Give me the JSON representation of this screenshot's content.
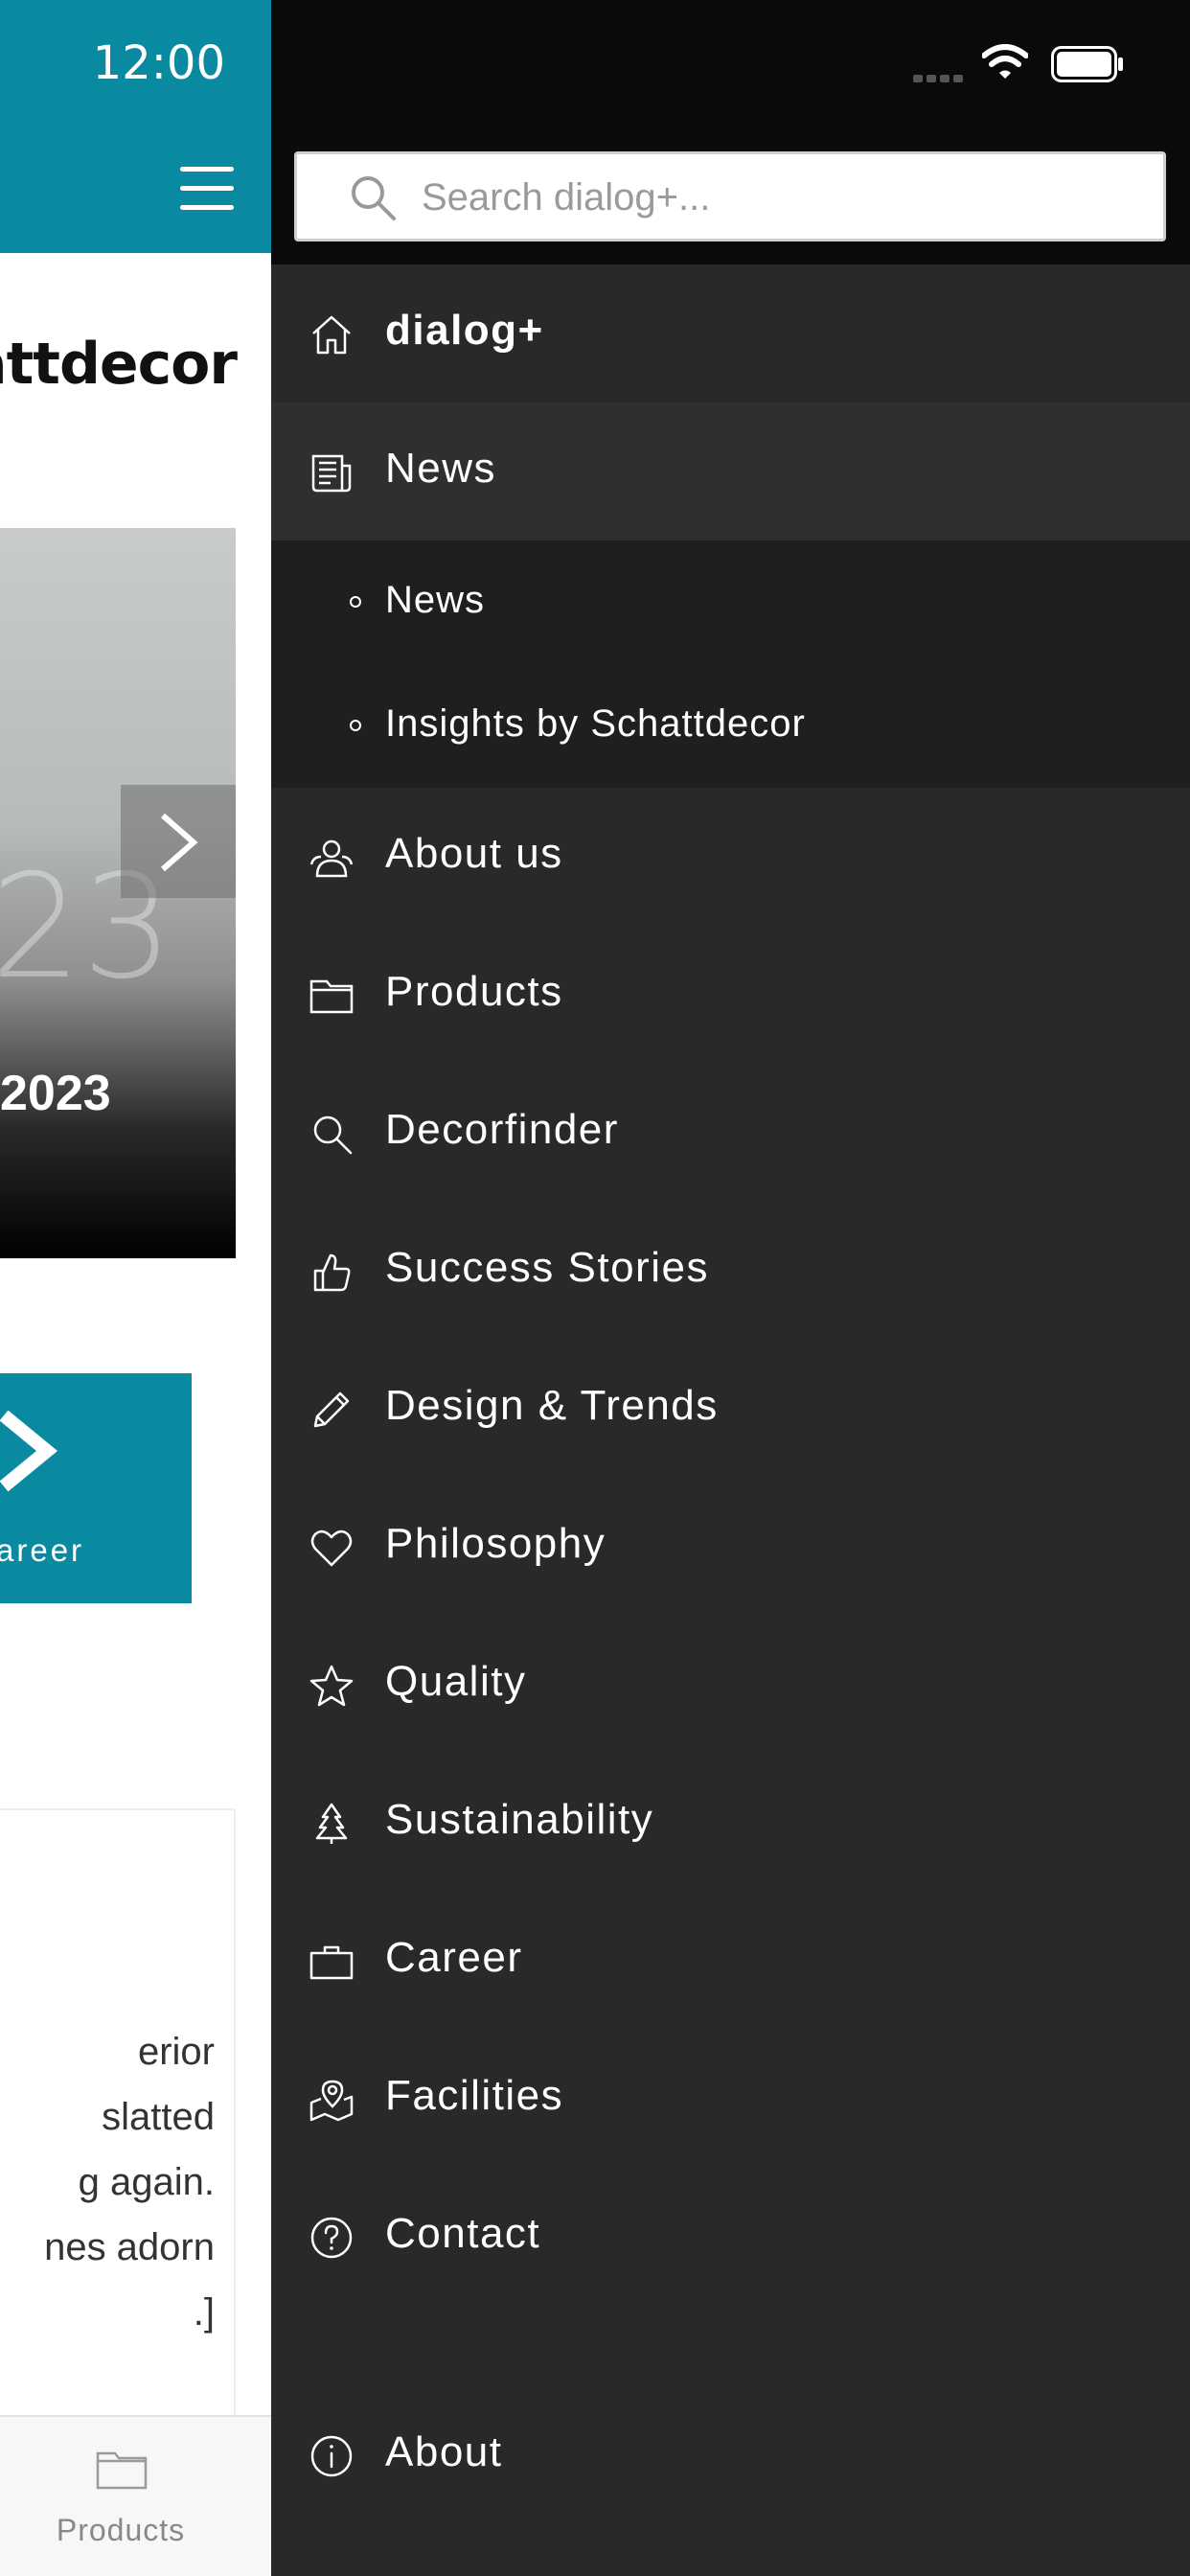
{
  "background_app": {
    "time": "12:00",
    "brand_logo": "attdecor",
    "hero_faint_text": "23",
    "hero_year": "2023",
    "career_label": "areer",
    "article_lines": [
      "erior",
      "slatted",
      "g again.",
      "nes adorn",
      ".]"
    ],
    "bottom_tab_label": "Products"
  },
  "drawer": {
    "search": {
      "placeholder": "Search dialog+..."
    },
    "menu": [
      {
        "label": "dialog+",
        "icon": "home-icon"
      },
      {
        "label": "News",
        "icon": "newspaper-icon",
        "expanded": true
      }
    ],
    "submenu": [
      {
        "label": "News"
      },
      {
        "label": "Insights by Schattdecor"
      }
    ],
    "menu_rest": [
      {
        "label": "About us",
        "icon": "people-icon"
      },
      {
        "label": "Products",
        "icon": "folder-icon"
      },
      {
        "label": "Decorfinder",
        "icon": "search-icon"
      },
      {
        "label": "Success Stories",
        "icon": "thumbs-up-icon"
      },
      {
        "label": "Design & Trends",
        "icon": "pencil-icon"
      },
      {
        "label": "Philosophy",
        "icon": "heart-icon"
      },
      {
        "label": "Quality",
        "icon": "star-icon"
      },
      {
        "label": "Sustainability",
        "icon": "tree-icon"
      },
      {
        "label": "Career",
        "icon": "briefcase-icon"
      },
      {
        "label": "Facilities",
        "icon": "map-pin-icon"
      },
      {
        "label": "Contact",
        "icon": "question-circle-icon"
      }
    ],
    "about": {
      "label": "About",
      "icon": "info-icon"
    }
  },
  "colors": {
    "brand_teal": "#0a8aa1",
    "drawer_bg": "#292929",
    "submenu_bg": "#1f1f1f",
    "statusbar_bg": "#0a0a0a"
  }
}
